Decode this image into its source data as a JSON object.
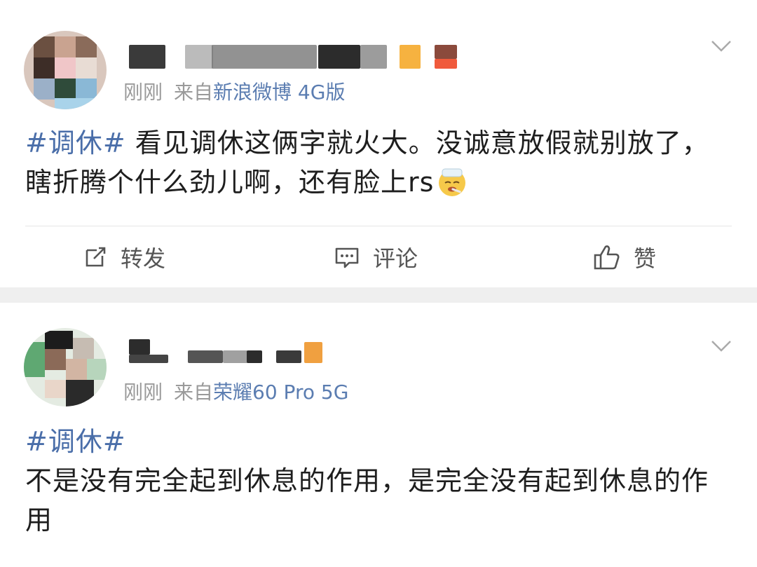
{
  "posts": [
    {
      "time": "刚刚",
      "source_prefix": "来自",
      "source": "新浪微博 4G版",
      "hashtag": "#调休#",
      "text": " 看见调休这俩字就火大。没诚意放假就别放了，瞎折腾个什么劲儿啊，还有脸上rs",
      "emoji_icon": "sick-face-emoji-icon",
      "actions": {
        "repost": "转发",
        "comment": "评论",
        "like": "赞"
      }
    },
    {
      "time": "刚刚",
      "source_prefix": "来自",
      "source": "荣耀60 Pro 5G",
      "hashtag": "#调休#",
      "text": "不是没有完全起到休息的作用，是完全没有起到休息的作用"
    }
  ],
  "colors": {
    "link": "#4a6ea9",
    "meta": "#9a9a9a",
    "separator": "#efefef"
  }
}
